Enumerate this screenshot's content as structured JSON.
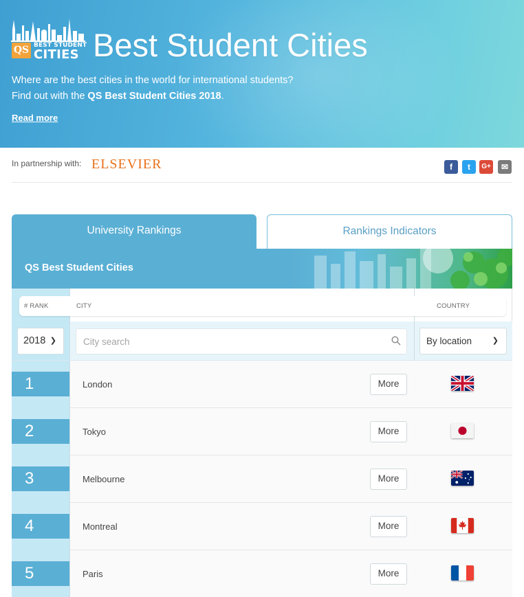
{
  "hero": {
    "logo_badge": "QS",
    "logo_line1": "BEST STUDENT",
    "logo_line2": "CITIES",
    "title": "Best Student Cities",
    "description_prefix": "Where are the best cities in the world for international students? Find out with the ",
    "description_bold": "QS Best Student Cities 2018",
    "description_suffix": ".",
    "read_more": "Read more"
  },
  "partner": {
    "label": "In partnership with:",
    "name": "ELSEVIER",
    "share": [
      "facebook",
      "twitter",
      "google-plus",
      "email"
    ],
    "fb_glyph": "f",
    "tw_glyph": "t",
    "gp_glyph": "G+",
    "em_glyph": "✉"
  },
  "tabs": {
    "active": "University Rankings",
    "inactive": "Rankings Indicators"
  },
  "table": {
    "banner_title": "QS Best Student Cities",
    "headers": {
      "rank": "# RANK",
      "city": "CITY",
      "country": "COUNTRY"
    },
    "year_value": "2018",
    "search_placeholder": "City search",
    "location_value": "By location",
    "more_label": "More",
    "rows": [
      {
        "rank": "1",
        "city": "London",
        "flag": "uk"
      },
      {
        "rank": "2",
        "city": "Tokyo",
        "flag": "jp"
      },
      {
        "rank": "3",
        "city": "Melbourne",
        "flag": "au"
      },
      {
        "rank": "4",
        "city": "Montreal",
        "flag": "ca"
      },
      {
        "rank": "5",
        "city": "Paris",
        "flag": "fr"
      }
    ]
  },
  "colors": {
    "accent": "#5aafd4",
    "rank_column": "#c5e8f5",
    "elsevier": "#e9711c"
  }
}
